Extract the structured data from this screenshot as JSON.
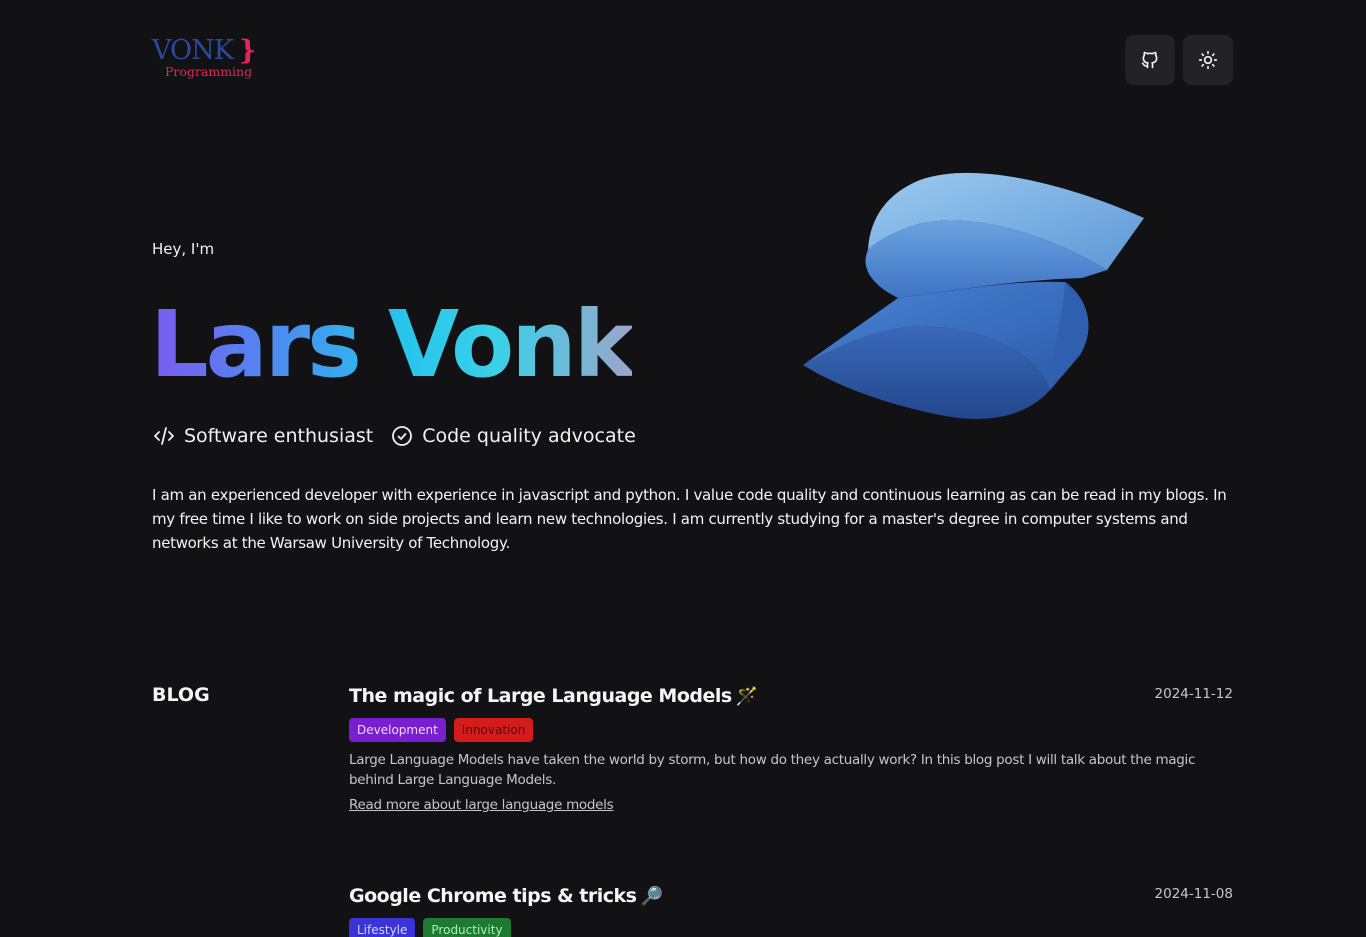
{
  "header": {
    "logo_main": "VONK",
    "logo_brace": "}",
    "logo_sub": "Programming",
    "github_icon": "github-icon",
    "theme_icon": "sun-icon"
  },
  "hero": {
    "greeting": "Hey, I'm",
    "name": "Lars Vonk",
    "traits": [
      {
        "icon": "code-icon",
        "label": "Software enthusiast"
      },
      {
        "icon": "check-circle-icon",
        "label": "Code quality advocate"
      }
    ],
    "bio": "I am an experienced developer with experience in javascript and python. I value code quality and continuous learning as can be read in my blogs. In my free time I like to work on side projects and learn new technologies. I am currently studying for a master's degree in computer systems and networks at the Warsaw University of Technology."
  },
  "blog": {
    "heading": "BLOG",
    "posts": [
      {
        "title": "The magic of Large Language Models",
        "emoji": "🪄",
        "date": "2024-11-12",
        "tags": [
          "Development",
          "Innovation"
        ],
        "description": "Large Language Models have taken the world by storm, but how do they actually work? In this blog post I will talk about the magic behind Large Language Models.",
        "link": "Read more about large language models"
      },
      {
        "title": "Google Chrome tips & tricks",
        "emoji": "🔎",
        "date": "2024-11-08",
        "tags": [
          "Lifestyle",
          "Productivity"
        ]
      }
    ]
  },
  "colors": {
    "background": "#121214",
    "accent_pink": "#e0245e",
    "logo_blue": "#2a4b9b"
  }
}
